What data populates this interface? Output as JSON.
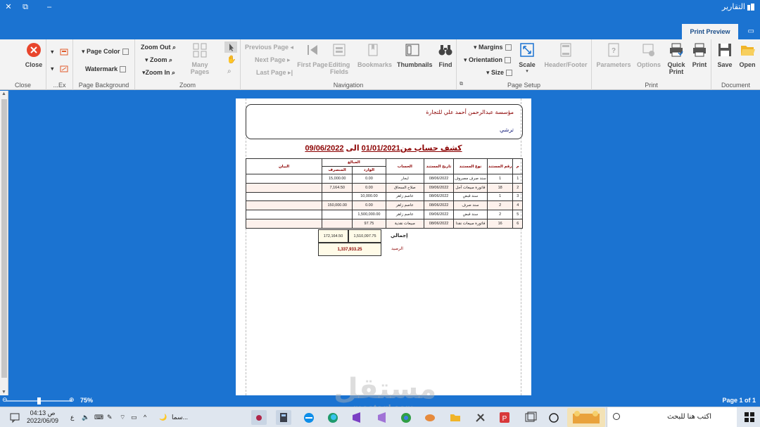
{
  "window": {
    "title": "التقارير",
    "close_glyph": "✕",
    "restore_glyph": "⧉",
    "minimize_glyph": "–"
  },
  "tabs": {
    "active": "Print Preview",
    "extra_glyph": "▭",
    "caret": "⌄"
  },
  "ribbon": {
    "close_group": {
      "close_label": "Close",
      "group_label": "Close"
    },
    "export_group": {
      "group_label": "...Ex"
    },
    "page_background": {
      "page_color": "Page Color",
      "watermark": "Watermark",
      "group_label": "Page Background"
    },
    "zoom": {
      "zoom_out": "Zoom Out",
      "zoom": "Zoom",
      "zoom_in": "Zoom In",
      "many_pages": "Many Pages",
      "group_label": "Zoom"
    },
    "navigation": {
      "previous_page": "Previous Page",
      "next_page": "Next  Page",
      "last_page": "Last  Page",
      "first_page": "First Page",
      "editing_fields": "Editing Fields",
      "bookmarks": "Bookmarks",
      "thumbnails": "Thumbnails",
      "find": "Find",
      "group_label": "Navigation"
    },
    "page_setup": {
      "margins": "Margins",
      "orientation": "Orientation",
      "size": "Size",
      "scale": "Scale",
      "header_footer": "Header/Footer",
      "group_label": "Page Setup"
    },
    "print": {
      "parameters": "Parameters",
      "options": "Options",
      "quick_print": "Quick Print",
      "print": "Print",
      "group_label": "Print"
    },
    "document": {
      "save": "Save",
      "open": "Open",
      "group_label": "Document"
    }
  },
  "report": {
    "company": "مؤسسة عبدالرحمن أحمد علي للتجارة",
    "subtitle": "ترشي",
    "title_prefix": "كشف حساب  من",
    "date_from": "01/01/2021",
    "title_mid": "  الى  ",
    "date_to": "09/06/2022",
    "headers": {
      "m": "م",
      "doc_no": "رقم المستند",
      "doc_type": "نوع المستند",
      "doc_date": "تاريخ المستند",
      "account": "الحساب",
      "amounts": "المبالغ",
      "incoming": "الوارد",
      "outgoing": "المنصرف",
      "statement": "البيان"
    },
    "rows": [
      {
        "m": "1",
        "doc_no": "1",
        "doc_type": "سند صرف مصروف",
        "date": "08/06/2022",
        "account": "ايجار",
        "incoming": "0.00",
        "outgoing": "15,000.00",
        "statement": ""
      },
      {
        "m": "2",
        "doc_no": "18",
        "doc_type": "فاتورة مبيعات آجل",
        "date": "09/06/2022",
        "account": "صلاح السحاق",
        "incoming": "0.00",
        "outgoing": "7,164.50",
        "statement": ""
      },
      {
        "m": "3",
        "doc_no": "1",
        "doc_type": "سند قبض",
        "date": "08/06/2022",
        "account": "عاصم زاهر",
        "incoming": "10,000.00",
        "outgoing": "",
        "statement": ""
      },
      {
        "m": "4",
        "doc_no": "2",
        "doc_type": "سند صرف",
        "date": "08/06/2022",
        "account": "عاصم زاهر",
        "incoming": "0.00",
        "outgoing": "150,000.00",
        "statement": ""
      },
      {
        "m": "5",
        "doc_no": "2",
        "doc_type": "سند قبض",
        "date": "09/06/2022",
        "account": "عاصم زاهر",
        "incoming": "1,500,000.00",
        "outgoing": "",
        "statement": ""
      },
      {
        "m": "6",
        "doc_no": "16",
        "doc_type": "فاتورة مبيعات نقدا",
        "date": "08/06/2022",
        "account": "مبيعات نقدية",
        "incoming": "97.75",
        "outgoing": "",
        "statement": ""
      }
    ],
    "totals_label": "إجمالي",
    "total_incoming": "1,510,097.75",
    "total_outgoing": "172,164.50",
    "balance_label": "الرصيد",
    "balance": "1,337,933.25"
  },
  "statusbar": {
    "zoom": "75%",
    "zoom_level": 0.5,
    "page_indicator": "Page 1 of 1"
  },
  "taskbar": {
    "time": "04:13 ص",
    "date": "2022/06/09",
    "lang": "ع",
    "notification": "سما...",
    "search_placeholder": "اكتب هنا للبحث"
  },
  "watermark": {
    "text": "مستقل",
    "sub": "mostaql.com"
  },
  "colors": {
    "accent": "#1b73d1",
    "ribbon_bg": "#f3f3f3",
    "report_red": "#8b0000",
    "close_red": "#e8452c"
  }
}
